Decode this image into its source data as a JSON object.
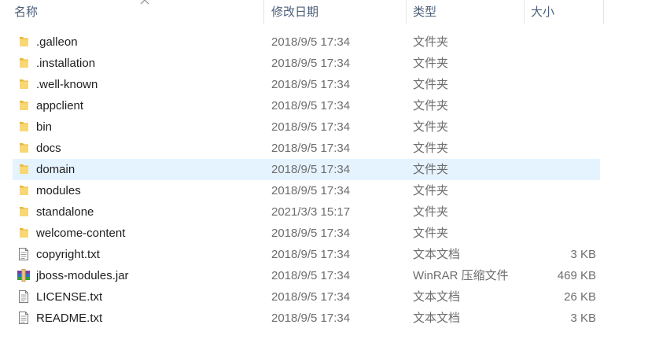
{
  "columns": {
    "name": "名称",
    "date": "修改日期",
    "type": "类型",
    "size": "大小"
  },
  "files": [
    {
      "name": ".galleon",
      "date": "2018/9/5 17:34",
      "type": "文件夹",
      "size": "",
      "icon": "folder-icon"
    },
    {
      "name": ".installation",
      "date": "2018/9/5 17:34",
      "type": "文件夹",
      "size": "",
      "icon": "folder-icon"
    },
    {
      "name": ".well-known",
      "date": "2018/9/5 17:34",
      "type": "文件夹",
      "size": "",
      "icon": "folder-icon"
    },
    {
      "name": "appclient",
      "date": "2018/9/5 17:34",
      "type": "文件夹",
      "size": "",
      "icon": "folder-icon"
    },
    {
      "name": "bin",
      "date": "2018/9/5 17:34",
      "type": "文件夹",
      "size": "",
      "icon": "folder-icon"
    },
    {
      "name": "docs",
      "date": "2018/9/5 17:34",
      "type": "文件夹",
      "size": "",
      "icon": "folder-icon"
    },
    {
      "name": "domain",
      "date": "2018/9/5 17:34",
      "type": "文件夹",
      "size": "",
      "icon": "folder-icon",
      "selected": true
    },
    {
      "name": "modules",
      "date": "2018/9/5 17:34",
      "type": "文件夹",
      "size": "",
      "icon": "folder-icon"
    },
    {
      "name": "standalone",
      "date": "2021/3/3 15:17",
      "type": "文件夹",
      "size": "",
      "icon": "folder-icon"
    },
    {
      "name": "welcome-content",
      "date": "2018/9/5 17:34",
      "type": "文件夹",
      "size": "",
      "icon": "folder-icon"
    },
    {
      "name": "copyright.txt",
      "date": "2018/9/5 17:34",
      "type": "文本文档",
      "size": "3 KB",
      "icon": "text-file-icon"
    },
    {
      "name": "jboss-modules.jar",
      "date": "2018/9/5 17:34",
      "type": "WinRAR 压缩文件",
      "size": "469 KB",
      "icon": "winrar-archive-icon"
    },
    {
      "name": "LICENSE.txt",
      "date": "2018/9/5 17:34",
      "type": "文本文档",
      "size": "26 KB",
      "icon": "text-file-icon"
    },
    {
      "name": "README.txt",
      "date": "2018/9/5 17:34",
      "type": "文本文档",
      "size": "3 KB",
      "icon": "text-file-icon"
    }
  ],
  "colors": {
    "selected_row": "#e5f3ff",
    "folder": "#f8d775",
    "header_text": "#4c607a"
  }
}
